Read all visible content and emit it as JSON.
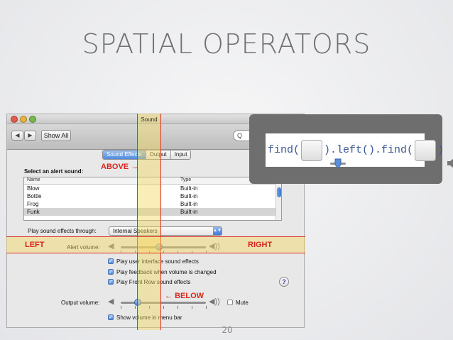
{
  "slide": {
    "title": "SPATIAL OPERATORS",
    "number": "20"
  },
  "window": {
    "title": "Sound",
    "toolbar": {
      "back": "◀",
      "forward": "▶",
      "show_all": "Show All",
      "search_placeholder": "Q"
    },
    "tabs": [
      {
        "label": "Sound Effects",
        "active": true
      },
      {
        "label": "Output",
        "active": false
      },
      {
        "label": "Input",
        "active": false
      }
    ],
    "select_alert_label": "Select an alert sound:",
    "list": {
      "columns": [
        "Name",
        "Type"
      ],
      "rows": [
        {
          "name": "Blow",
          "type": "Built-in",
          "selected": false
        },
        {
          "name": "Bottle",
          "type": "Built-in",
          "selected": false
        },
        {
          "name": "Frog",
          "type": "Built-in",
          "selected": false
        },
        {
          "name": "Funk",
          "type": "Built-in",
          "selected": true
        }
      ]
    },
    "play_through_label": "Play sound effects through:",
    "play_through_value": "Internal Speakers",
    "alert_volume_label": "Alert volume:",
    "alert_volume_level": 0.45,
    "checkboxes": [
      {
        "label": "Play user interface sound effects",
        "checked": true
      },
      {
        "label": "Play feedback when volume is changed",
        "checked": true
      },
      {
        "label": "Play Front Row sound effects",
        "checked": true
      }
    ],
    "help": "?",
    "output_volume_label": "Output volume:",
    "output_volume_level": 0.2,
    "mute_label": "Mute",
    "mute_checked": false,
    "show_volume_label": "Show volume in menu bar",
    "show_volume_checked": true
  },
  "annotations": {
    "above": "ABOVE",
    "below": "BELOW",
    "left": "LEFT",
    "right": "RIGHT",
    "arrow_left": "←",
    "arrow_right": "→"
  },
  "code": {
    "part1": "find(",
    "part2": ").left().find(",
    "part3": ")"
  },
  "colors": {
    "annotation_red": "#d9251e",
    "highlight_band": "#f6d660",
    "code_text": "#3b5998"
  },
  "icons": {
    "slider_thumb": "slider-thumb-icon",
    "speaker": "speaker-icon"
  }
}
